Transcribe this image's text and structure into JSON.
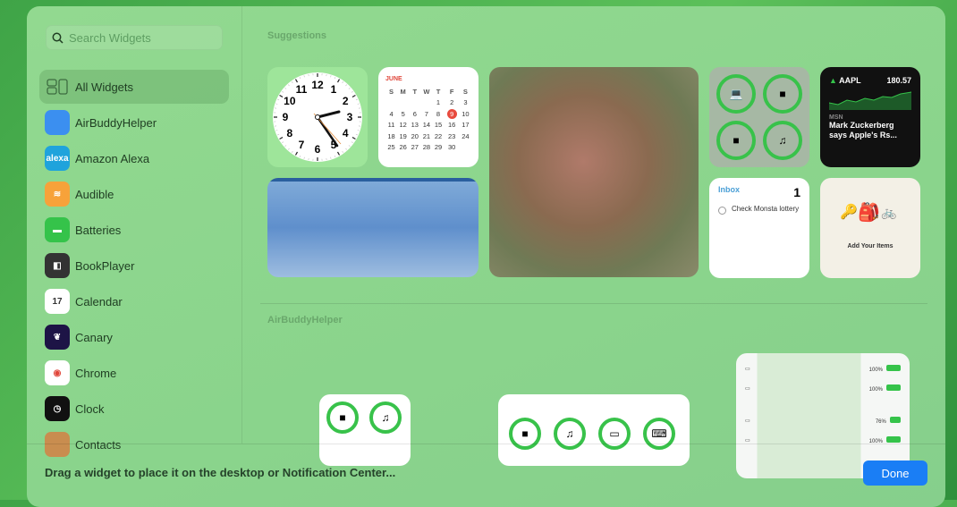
{
  "search": {
    "placeholder": "Search Widgets"
  },
  "sidebar": {
    "items": [
      {
        "label": "All Widgets",
        "icon": "widgets-grid-icon",
        "color": "transparent"
      },
      {
        "label": "AirBuddyHelper",
        "icon": "airbuddy-app-icon",
        "color": "#3b8ff0"
      },
      {
        "label": "Amazon Alexa",
        "icon": "alexa-app-icon",
        "color": "#1fa3dc",
        "glyph": "alexa"
      },
      {
        "label": "Audible",
        "icon": "audible-app-icon",
        "color": "#f7a23a",
        "glyph": "≋"
      },
      {
        "label": "Batteries",
        "icon": "batteries-app-icon",
        "color": "#35c34a",
        "glyph": "▬"
      },
      {
        "label": "BookPlayer",
        "icon": "bookplayer-app-icon",
        "color": "#333",
        "glyph": "◧"
      },
      {
        "label": "Calendar",
        "icon": "calendar-app-icon",
        "color": "#fff",
        "glyph": "17"
      },
      {
        "label": "Canary",
        "icon": "canary-app-icon",
        "color": "#1d1446",
        "glyph": "❦"
      },
      {
        "label": "Chrome",
        "icon": "chrome-app-icon",
        "color": "#fff",
        "glyph": "◉"
      },
      {
        "label": "Clock",
        "icon": "clock-app-icon",
        "color": "#111",
        "glyph": "◷"
      },
      {
        "label": "Contacts",
        "icon": "contacts-app-icon",
        "color": "#c98d4f",
        "glyph": ""
      }
    ]
  },
  "sections": {
    "suggestions": "Suggestions",
    "airbuddy": "AirBuddyHelper"
  },
  "clock": {
    "numbers": [
      "12",
      "1",
      "2",
      "3",
      "4",
      "5",
      "6",
      "7",
      "8",
      "9",
      "10",
      "11"
    ]
  },
  "calendar": {
    "month": "JUNE",
    "weekdays": [
      "S",
      "M",
      "T",
      "W",
      "T",
      "F",
      "S"
    ],
    "weeks": [
      [
        "",
        "",
        "",
        "",
        "1",
        "2",
        "3"
      ],
      [
        "4",
        "5",
        "6",
        "7",
        "8",
        "9",
        "10"
      ],
      [
        "11",
        "12",
        "13",
        "14",
        "15",
        "16",
        "17"
      ],
      [
        "18",
        "19",
        "20",
        "21",
        "22",
        "23",
        "24"
      ],
      [
        "25",
        "26",
        "27",
        "28",
        "29",
        "30",
        ""
      ]
    ],
    "today": "9"
  },
  "stocks": {
    "symbol": "AAPL",
    "price": "180.57",
    "source": "MSN",
    "headline": "Mark Zuckerberg says Apple's Rs..."
  },
  "reminders": {
    "list": "Inbox",
    "count": "1",
    "item": "Check Monsta lottery"
  },
  "findmy": {
    "label": "Add Your Items"
  },
  "batteries_list": [
    {
      "pct": "100%"
    },
    {
      "pct": "100%"
    },
    {
      "pct": "76%"
    },
    {
      "pct": "100%"
    }
  ],
  "footer": {
    "hint": "Drag a widget to place it on the desktop or Notification Center...",
    "done": "Done"
  }
}
